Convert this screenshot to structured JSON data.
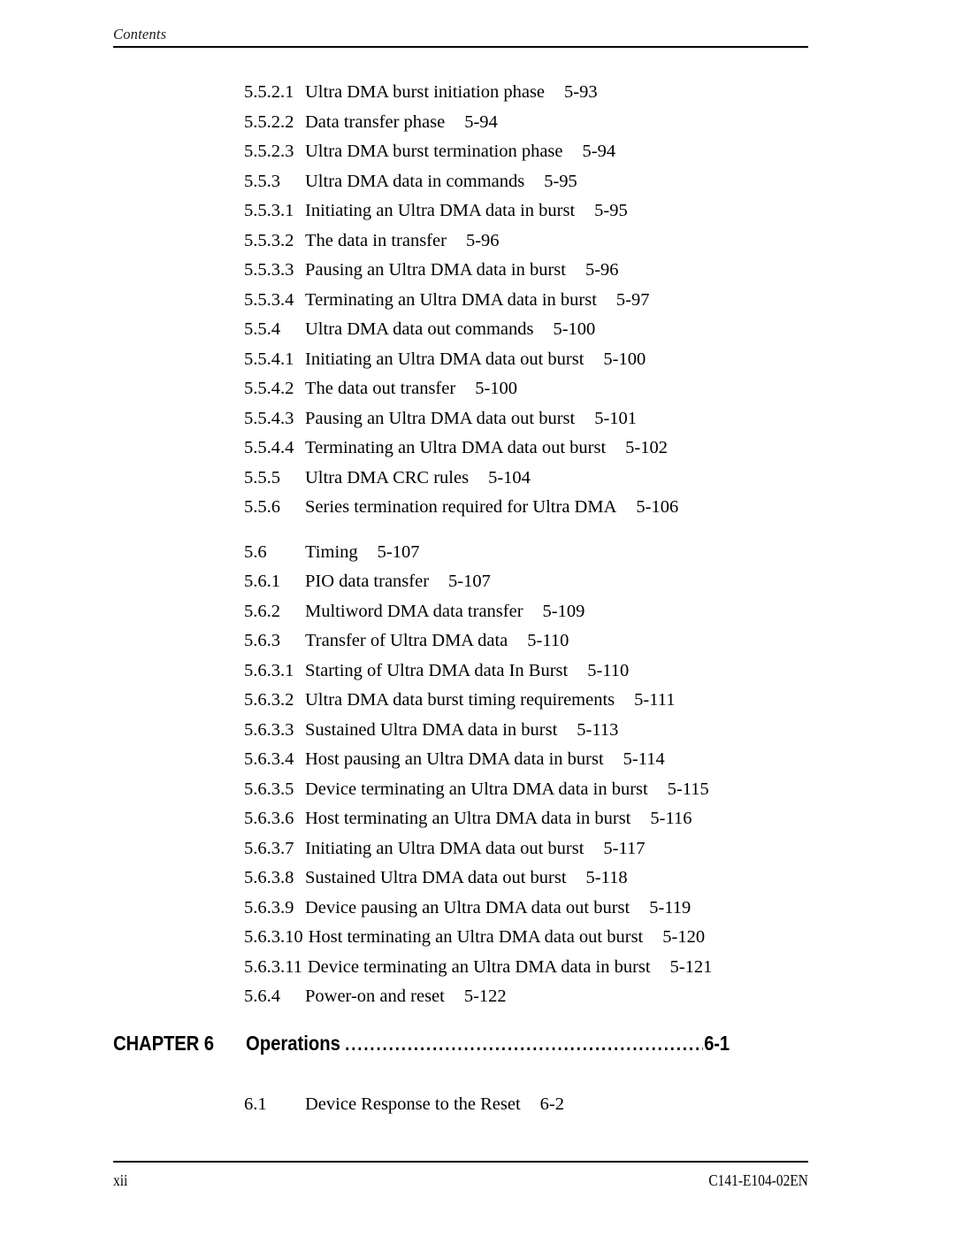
{
  "header": {
    "label": "Contents"
  },
  "toc": {
    "entries": [
      {
        "number": "5.5.2.1",
        "title": "Ultra DMA burst initiation phase",
        "page": "5-93",
        "level": 4,
        "gap_before": false
      },
      {
        "number": "5.5.2.2",
        "title": "Data transfer phase",
        "page": "5-94",
        "level": 4,
        "gap_before": false
      },
      {
        "number": "5.5.2.3",
        "title": "Ultra DMA burst termination phase",
        "page": "5-94",
        "level": 4,
        "gap_before": false
      },
      {
        "number": "5.5.3",
        "title": "Ultra DMA data in commands",
        "page": "5-95",
        "level": 3,
        "gap_before": false
      },
      {
        "number": "5.5.3.1",
        "title": "Initiating an Ultra DMA data in burst",
        "page": "5-95",
        "level": 4,
        "gap_before": false
      },
      {
        "number": "5.5.3.2",
        "title": "The data in transfer",
        "page": "5-96",
        "level": 4,
        "gap_before": false
      },
      {
        "number": "5.5.3.3",
        "title": "Pausing an Ultra DMA data in burst",
        "page": "5-96",
        "level": 4,
        "gap_before": false
      },
      {
        "number": "5.5.3.4",
        "title": "Terminating an Ultra DMA data in burst",
        "page": "5-97",
        "level": 4,
        "gap_before": false
      },
      {
        "number": "5.5.4",
        "title": "Ultra DMA data out commands",
        "page": "5-100",
        "level": 3,
        "gap_before": false
      },
      {
        "number": "5.5.4.1",
        "title": "Initiating an Ultra DMA data out burst",
        "page": "5-100",
        "level": 4,
        "gap_before": false
      },
      {
        "number": "5.5.4.2",
        "title": "The data out transfer",
        "page": "5-100",
        "level": 4,
        "gap_before": false
      },
      {
        "number": "5.5.4.3",
        "title": "Pausing an Ultra DMA data out burst",
        "page": "5-101",
        "level": 4,
        "gap_before": false
      },
      {
        "number": "5.5.4.4",
        "title": "Terminating an Ultra DMA data out burst",
        "page": "5-102",
        "level": 4,
        "gap_before": false
      },
      {
        "number": "5.5.5",
        "title": "Ultra DMA CRC rules",
        "page": "5-104",
        "level": 3,
        "gap_before": false
      },
      {
        "number": "5.5.6",
        "title": "Series termination required for Ultra DMA",
        "page": "5-106",
        "level": 3,
        "gap_before": false
      },
      {
        "number": "5.6",
        "title": "Timing",
        "page": "5-107",
        "level": 2,
        "gap_before": true
      },
      {
        "number": "5.6.1",
        "title": "PIO data transfer",
        "page": "5-107",
        "level": 3,
        "gap_before": false
      },
      {
        "number": "5.6.2",
        "title": "Multiword DMA data transfer",
        "page": "5-109",
        "level": 3,
        "gap_before": false
      },
      {
        "number": "5.6.3",
        "title": "Transfer of Ultra DMA data",
        "page": "5-110",
        "level": 3,
        "gap_before": false
      },
      {
        "number": "5.6.3.1",
        "title": "Starting of Ultra DMA data In Burst",
        "page": "5-110",
        "level": 4,
        "gap_before": false
      },
      {
        "number": "5.6.3.2",
        "title": "Ultra DMA data burst timing requirements",
        "page": "5-111",
        "level": 4,
        "gap_before": false
      },
      {
        "number": "5.6.3.3",
        "title": "Sustained Ultra DMA data in burst",
        "page": "5-113",
        "level": 4,
        "gap_before": false
      },
      {
        "number": "5.6.3.4",
        "title": "Host pausing an Ultra DMA data in burst",
        "page": "5-114",
        "level": 4,
        "gap_before": false
      },
      {
        "number": "5.6.3.5",
        "title": "Device terminating an Ultra DMA data in burst",
        "page": "5-115",
        "level": 4,
        "gap_before": false
      },
      {
        "number": "5.6.3.6",
        "title": "Host terminating an Ultra DMA data in burst",
        "page": "5-116",
        "level": 4,
        "gap_before": false
      },
      {
        "number": "5.6.3.7",
        "title": "Initiating an Ultra DMA data out burst",
        "page": "5-117",
        "level": 4,
        "gap_before": false
      },
      {
        "number": "5.6.3.8",
        "title": "Sustained Ultra DMA data out burst",
        "page": "5-118",
        "level": 4,
        "gap_before": false
      },
      {
        "number": "5.6.3.9",
        "title": "Device pausing an Ultra DMA data out burst",
        "page": "5-119",
        "level": 4,
        "gap_before": false
      },
      {
        "number": "5.6.3.10",
        "title": "Host terminating an Ultra DMA data out burst",
        "page": "5-120",
        "level": 5,
        "gap_before": false
      },
      {
        "number": "5.6.3.11",
        "title": "Device terminating an Ultra DMA data in burst",
        "page": "5-121",
        "level": 5,
        "gap_before": false
      },
      {
        "number": "5.6.4",
        "title": "Power-on and reset",
        "page": "5-122",
        "level": 3,
        "gap_before": false
      }
    ]
  },
  "chapter": {
    "label": "CHAPTER 6",
    "title": "Operations",
    "leader": "..........................................................................",
    "page": "6-1"
  },
  "post_chapter": {
    "entries": [
      {
        "number": "6.1",
        "title": "Device Response to the Reset",
        "page": "6-2",
        "level": 2,
        "gap_before": false
      }
    ]
  },
  "footer": {
    "page_number": "xii",
    "document_id": "C141-E104-02EN"
  }
}
